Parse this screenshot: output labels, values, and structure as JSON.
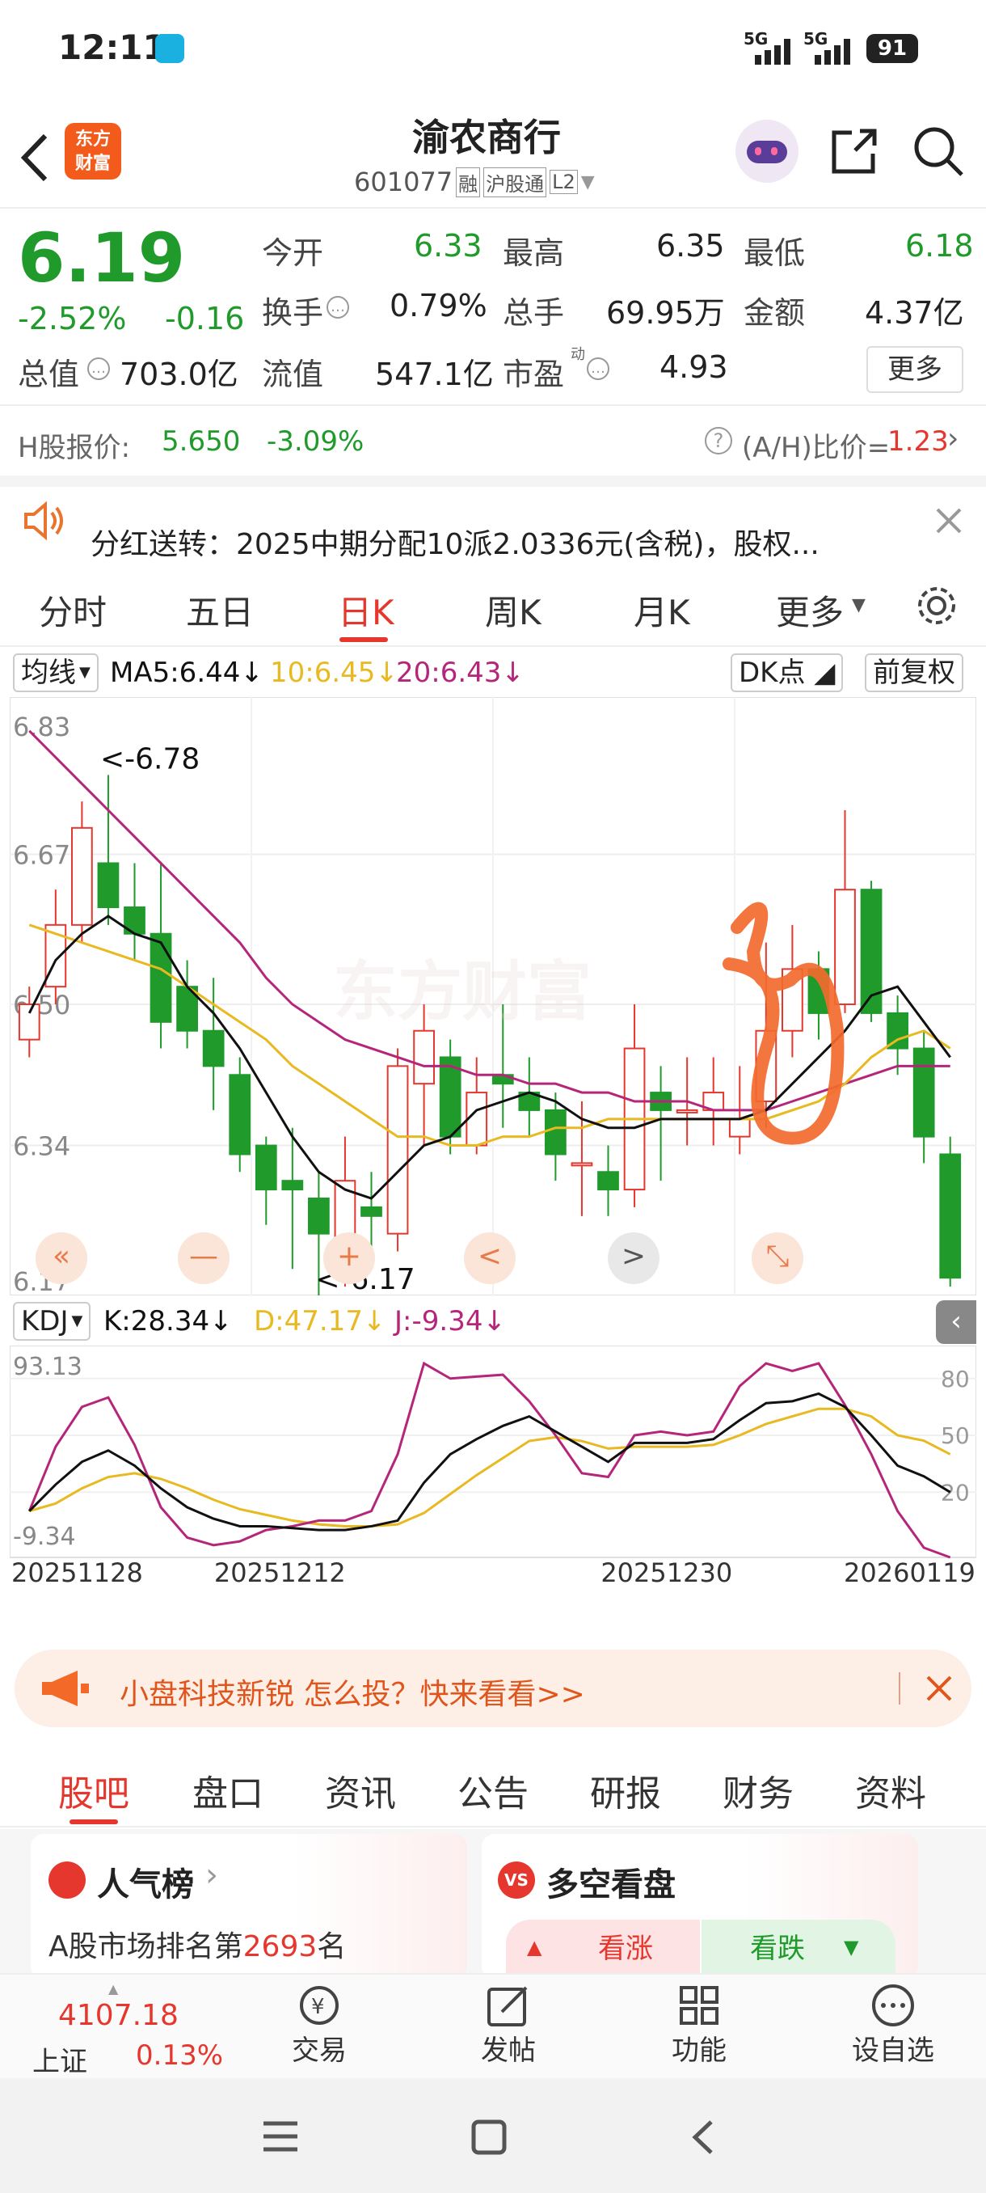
{
  "status": {
    "time": "12:11",
    "signal1": "5G",
    "signal2": "5G",
    "battery": "91"
  },
  "header": {
    "logo_text": "东方\n财富",
    "title": "渝农商行",
    "code": "601077",
    "tag_rong": "融",
    "tag_hgt": "沪股通",
    "tag_l2": "L2"
  },
  "quote": {
    "price": "6.19",
    "change_pct": "-2.52%",
    "change_amt": "-0.16",
    "open_label": "今开",
    "open": "6.33",
    "high_label": "最高",
    "high": "6.35",
    "low_label": "最低",
    "low": "6.18",
    "turnover_label": "换手",
    "turnover": "0.79%",
    "volume_label": "总手",
    "volume": "69.95万",
    "amount_label": "金额",
    "amount": "4.37亿",
    "mktcap_label": "总值",
    "mktcap": "703.0亿",
    "float_label": "流值",
    "float": "547.1亿",
    "pe_label": "市盈",
    "pe_sup": "动",
    "pe": "4.93",
    "more": "更多"
  },
  "hshare": {
    "label": "H股报价:",
    "price": "5.650",
    "pct": "-3.09%",
    "ah_label": "(A/H)比价=",
    "ah_value": "1.23"
  },
  "notice": {
    "text": "分红送转：2025中期分配10派2.0336元(含税)，股权..."
  },
  "tabs": [
    "分时",
    "五日",
    "日K",
    "周K",
    "月K",
    "更多"
  ],
  "ma": {
    "selector": "均线",
    "ma5": "MA5:6.44",
    "ma10": "10:6.45",
    "ma20": "20:6.43",
    "dk": "DK点",
    "fq": "前复权"
  },
  "colors": {
    "up": "#e5372d",
    "down": "#1f9a2b",
    "ma5": "#111111",
    "ma10": "#e8b920",
    "ma20": "#b5267a",
    "draw": "#f26a2e"
  },
  "chart_data": {
    "type": "candlestick",
    "y_ticks": [
      "6.83",
      "6.67",
      "6.50",
      "6.34",
      "6.17"
    ],
    "max_label": "<-6.78",
    "min_label": "<-6.17",
    "x_labels": [
      "20251128",
      "20251212",
      "20251230",
      "20260119"
    ],
    "candles": [
      {
        "o": 6.46,
        "c": 6.5,
        "h": 6.52,
        "l": 6.44
      },
      {
        "o": 6.52,
        "c": 6.59,
        "h": 6.63,
        "l": 6.5
      },
      {
        "o": 6.59,
        "c": 6.7,
        "h": 6.73,
        "l": 6.57
      },
      {
        "o": 6.66,
        "c": 6.61,
        "h": 6.76,
        "l": 6.59
      },
      {
        "o": 6.61,
        "c": 6.58,
        "h": 6.66,
        "l": 6.55
      },
      {
        "o": 6.58,
        "c": 6.48,
        "h": 6.66,
        "l": 6.45
      },
      {
        "o": 6.52,
        "c": 6.47,
        "h": 6.55,
        "l": 6.45
      },
      {
        "o": 6.47,
        "c": 6.43,
        "h": 6.53,
        "l": 6.38
      },
      {
        "o": 6.42,
        "c": 6.33,
        "h": 6.44,
        "l": 6.31
      },
      {
        "o": 6.34,
        "c": 6.29,
        "h": 6.35,
        "l": 6.25
      },
      {
        "o": 6.3,
        "c": 6.29,
        "h": 6.36,
        "l": 6.2
      },
      {
        "o": 6.28,
        "c": 6.24,
        "h": 6.31,
        "l": 6.17
      },
      {
        "o": 6.23,
        "c": 6.3,
        "h": 6.35,
        "l": 6.18
      },
      {
        "o": 6.27,
        "c": 6.26,
        "h": 6.31,
        "l": 6.21
      },
      {
        "o": 6.24,
        "c": 6.43,
        "h": 6.45,
        "l": 6.22
      },
      {
        "o": 6.41,
        "c": 6.47,
        "h": 6.5,
        "l": 6.34
      },
      {
        "o": 6.44,
        "c": 6.35,
        "h": 6.46,
        "l": 6.33
      },
      {
        "o": 6.34,
        "c": 6.4,
        "h": 6.44,
        "l": 6.33
      },
      {
        "o": 6.42,
        "c": 6.41,
        "h": 6.5,
        "l": 6.36
      },
      {
        "o": 6.4,
        "c": 6.38,
        "h": 6.44,
        "l": 6.35
      },
      {
        "o": 6.38,
        "c": 6.33,
        "h": 6.4,
        "l": 6.3
      },
      {
        "o": 6.32,
        "c": 6.32,
        "h": 6.39,
        "l": 6.26
      },
      {
        "o": 6.31,
        "c": 6.29,
        "h": 6.34,
        "l": 6.26
      },
      {
        "o": 6.29,
        "c": 6.45,
        "h": 6.5,
        "l": 6.27
      },
      {
        "o": 6.4,
        "c": 6.38,
        "h": 6.43,
        "l": 6.3
      },
      {
        "o": 6.38,
        "c": 6.38,
        "h": 6.44,
        "l": 6.34
      },
      {
        "o": 6.38,
        "c": 6.4,
        "h": 6.44,
        "l": 6.34
      },
      {
        "o": 6.35,
        "c": 6.37,
        "h": 6.43,
        "l": 6.33
      },
      {
        "o": 6.39,
        "c": 6.47,
        "h": 6.57,
        "l": 6.36
      },
      {
        "o": 6.47,
        "c": 6.54,
        "h": 6.59,
        "l": 6.44
      },
      {
        "o": 6.54,
        "c": 6.49,
        "h": 6.56,
        "l": 6.46
      },
      {
        "o": 6.5,
        "c": 6.63,
        "h": 6.72,
        "l": 6.49
      },
      {
        "o": 6.63,
        "c": 6.49,
        "h": 6.64,
        "l": 6.48
      },
      {
        "o": 6.49,
        "c": 6.45,
        "h": 6.51,
        "l": 6.42
      },
      {
        "o": 6.45,
        "c": 6.35,
        "h": 6.47,
        "l": 6.32
      },
      {
        "o": 6.33,
        "c": 6.19,
        "h": 6.35,
        "l": 6.18
      }
    ],
    "ma5": [
      6.49,
      6.55,
      6.58,
      6.6,
      6.58,
      6.57,
      6.52,
      6.49,
      6.45,
      6.4,
      6.35,
      6.31,
      6.29,
      6.28,
      6.31,
      6.34,
      6.35,
      6.38,
      6.39,
      6.4,
      6.39,
      6.37,
      6.36,
      6.36,
      6.37,
      6.37,
      6.37,
      6.37,
      6.38,
      6.41,
      6.44,
      6.47,
      6.51,
      6.52,
      6.48,
      6.44
    ],
    "ma10": [
      6.59,
      6.58,
      6.57,
      6.56,
      6.55,
      6.54,
      6.52,
      6.5,
      6.48,
      6.46,
      6.43,
      6.41,
      6.39,
      6.37,
      6.35,
      6.35,
      6.34,
      6.34,
      6.35,
      6.35,
      6.36,
      6.36,
      6.37,
      6.37,
      6.37,
      6.37,
      6.37,
      6.37,
      6.37,
      6.38,
      6.39,
      6.41,
      6.44,
      6.46,
      6.47,
      6.45
    ],
    "ma20": [
      6.81,
      6.78,
      6.75,
      6.72,
      6.69,
      6.66,
      6.63,
      6.6,
      6.57,
      6.53,
      6.5,
      6.48,
      6.46,
      6.45,
      6.44,
      6.43,
      6.43,
      6.42,
      6.42,
      6.41,
      6.41,
      6.4,
      6.4,
      6.39,
      6.39,
      6.39,
      6.38,
      6.38,
      6.38,
      6.39,
      6.4,
      6.41,
      6.42,
      6.43,
      6.43,
      6.43
    ],
    "kdj": {
      "labels": {
        "selector": "KDJ",
        "k": "K:28.34",
        "d": "D:47.17",
        "j": "J:-9.34"
      },
      "y_ticks_left": [
        "93.13",
        "-9.34"
      ],
      "y_ticks_right": [
        "80",
        "50",
        "20"
      ],
      "range": [
        -9.34,
        93.13
      ],
      "k": [
        10,
        24,
        36,
        42,
        34,
        22,
        12,
        6,
        2,
        2,
        1,
        0,
        0,
        2,
        5,
        25,
        40,
        48,
        55,
        60,
        52,
        44,
        36,
        46,
        46,
        46,
        48,
        58,
        67,
        68,
        72,
        65,
        50,
        34,
        28.34,
        20
      ],
      "d": [
        10,
        14,
        22,
        28,
        30,
        27,
        22,
        16,
        11,
        8,
        5,
        3,
        2,
        2,
        3,
        9,
        19,
        29,
        38,
        47,
        49,
        47,
        43,
        44,
        44,
        44,
        45,
        50,
        56,
        60,
        64,
        64,
        60,
        50,
        47.17,
        40
      ],
      "j": [
        10,
        44,
        65,
        70,
        45,
        12,
        -4,
        -8,
        -6,
        0,
        2,
        5,
        5,
        10,
        40,
        88,
        80,
        81,
        82,
        68,
        50,
        30,
        28,
        50,
        52,
        50,
        52,
        76,
        88,
        84,
        88,
        66,
        40,
        10,
        -9.34,
        -20
      ]
    }
  },
  "chart_controls": [
    "«",
    "—",
    "+",
    "<",
    ">",
    "⤡"
  ],
  "watermark": "东方财富",
  "ad": {
    "text": "小盘科技新锐 怎么投？快来看看>>"
  },
  "bottom_tabs": [
    "股吧",
    "盘口",
    "资讯",
    "公告",
    "研报",
    "财务",
    "资料"
  ],
  "cards": {
    "left_title": "人气榜",
    "left_sub_prefix": "A股市场排名第",
    "left_rank": "2693",
    "left_sub_suffix": "名",
    "right_title": "多空看盘",
    "right_up": "看涨",
    "right_down": "看跌"
  },
  "index": {
    "value": "4107.18",
    "name": "上证",
    "pct": "0.13%"
  },
  "bottom_bar": [
    "交易",
    "发帖",
    "功能",
    "设自选"
  ]
}
